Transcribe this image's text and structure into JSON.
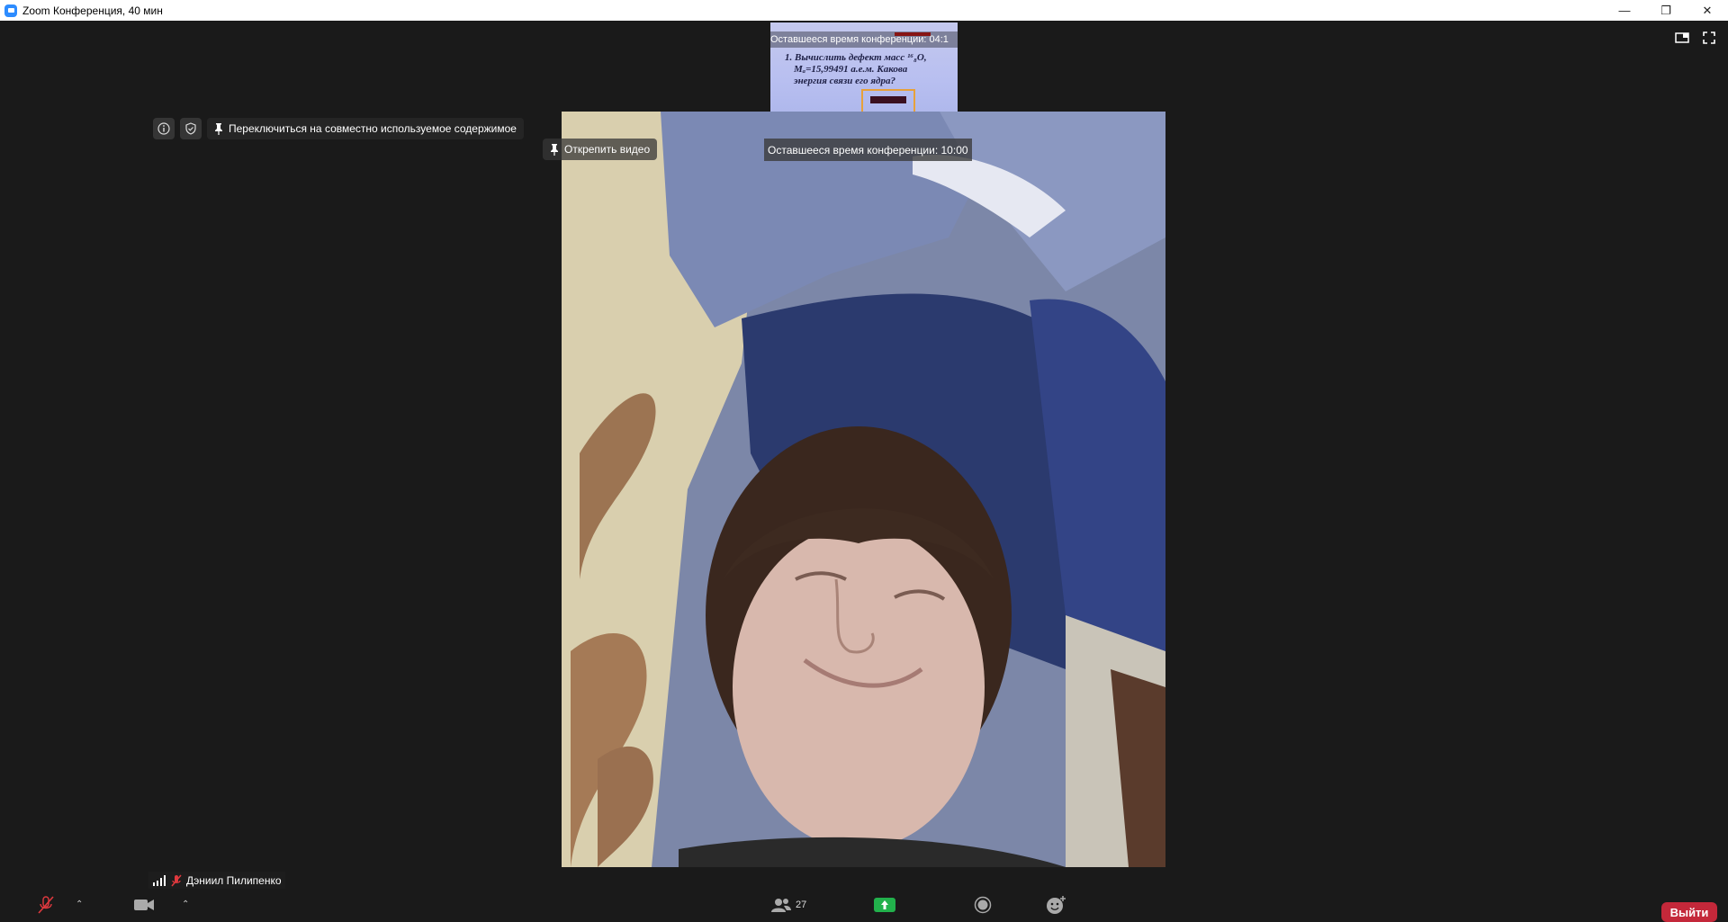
{
  "window": {
    "title": "Zoom Конференция, 40 мин"
  },
  "thumbnail": {
    "timer_text": "Оставшееся время конференции: 04:1",
    "slide_lines": [
      "1. Вычислить дефект масс ¹⁶₈O,",
      "Mₐ=15,99491 а.е.м. Какова",
      "энергия связи его ядра?"
    ]
  },
  "video": {
    "info_icon": "info-icon",
    "shield_icon": "shield-icon",
    "switch_label": "Переключиться на совместно используемое содержимое",
    "unpin_label": "Открепить видео",
    "timer_text": "Оставшееся время конференции: 10:00",
    "participant_name": "Дэниил Пилипенко"
  },
  "toolbar": {
    "participants_count": "27",
    "leave_label": "Выйти"
  },
  "colors": {
    "accent": "#2d8cff",
    "leave": "#c4283a",
    "share": "#22b14c"
  }
}
